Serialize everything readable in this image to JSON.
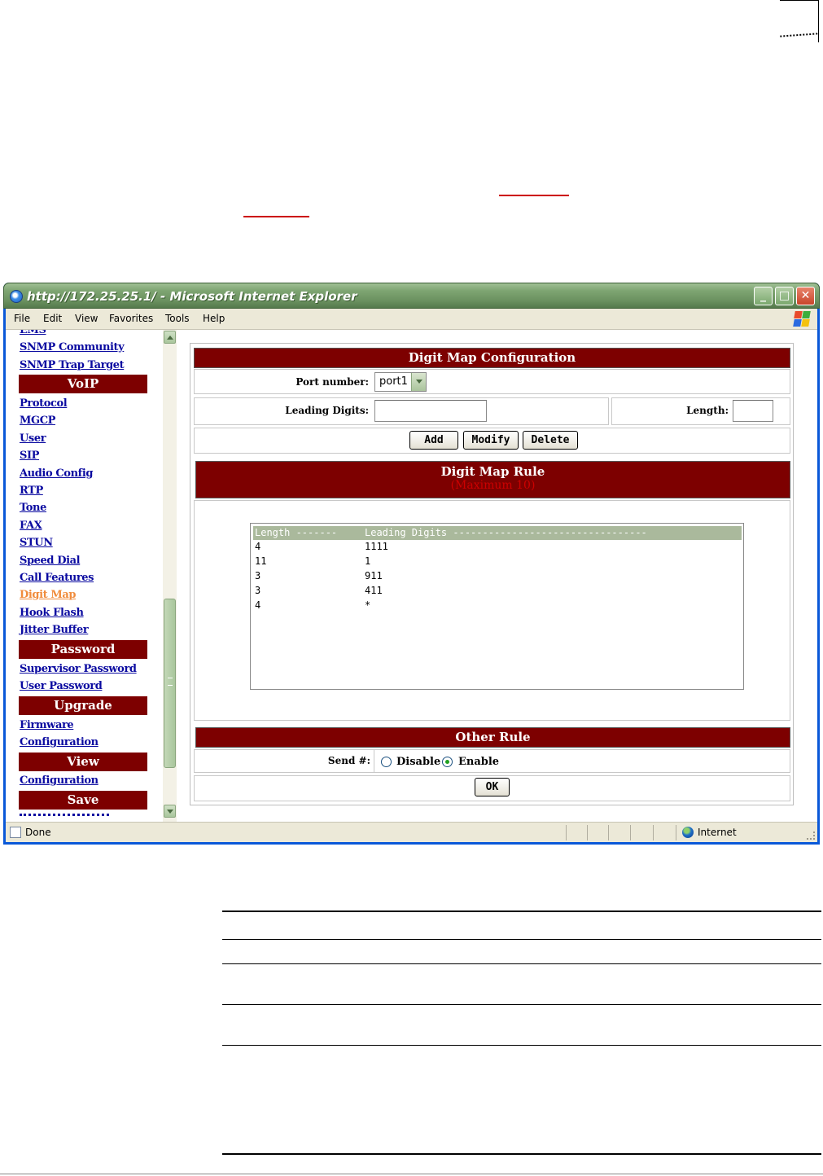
{
  "window": {
    "title": "http://172.25.25.1/ - Microsoft Internet Explorer",
    "buttons": [
      "minimize-icon",
      "maximize-icon",
      "close-icon"
    ]
  },
  "menu": [
    "File",
    "Edit",
    "View",
    "Favorites",
    "Tools",
    "Help"
  ],
  "sidebar": {
    "partial_top": "EMS",
    "items": [
      {
        "type": "link",
        "label": "SNMP Community"
      },
      {
        "type": "link",
        "label": "SNMP Trap Target"
      },
      {
        "type": "header",
        "label": "VoIP"
      },
      {
        "type": "link",
        "label": "Protocol"
      },
      {
        "type": "link",
        "label": "MGCP"
      },
      {
        "type": "link",
        "label": "User"
      },
      {
        "type": "link",
        "label": "SIP"
      },
      {
        "type": "link",
        "label": "Audio Config"
      },
      {
        "type": "link",
        "label": "RTP"
      },
      {
        "type": "link",
        "label": "Tone"
      },
      {
        "type": "link",
        "label": "FAX"
      },
      {
        "type": "link",
        "label": "STUN"
      },
      {
        "type": "link",
        "label": "Speed Dial"
      },
      {
        "type": "link",
        "label": "Call Features"
      },
      {
        "type": "link",
        "label": "Digit Map",
        "active": true
      },
      {
        "type": "link",
        "label": "Hook Flash"
      },
      {
        "type": "link",
        "label": "Jitter Buffer"
      },
      {
        "type": "header",
        "label": "Password"
      },
      {
        "type": "link",
        "label": "Supervisor Password"
      },
      {
        "type": "link",
        "label": "User Password"
      },
      {
        "type": "header",
        "label": "Upgrade"
      },
      {
        "type": "link",
        "label": "Firmware"
      },
      {
        "type": "link",
        "label": "Configuration"
      },
      {
        "type": "header",
        "label": "View"
      },
      {
        "type": "link",
        "label": "Configuration"
      },
      {
        "type": "header",
        "label": "Save"
      }
    ]
  },
  "config": {
    "title": "Digit Map Configuration",
    "port_label": "Port number:",
    "port_value": "port1",
    "leading_label": "Leading Digits:",
    "leading_value": "",
    "length_label": "Length:",
    "length_value": "",
    "add": "Add",
    "modify": "Modify",
    "delete": "Delete"
  },
  "rules": {
    "title": "Digit Map Rule",
    "subtitle": "(Maximum 10)",
    "header_length": "Length -------",
    "header_digits": "Leading Digits ---------------------------------",
    "rows": [
      {
        "length": "4",
        "digits": "1111"
      },
      {
        "length": "11",
        "digits": "1"
      },
      {
        "length": "3",
        "digits": "911"
      },
      {
        "length": "3",
        "digits": "411"
      },
      {
        "length": "4",
        "digits": "*"
      }
    ]
  },
  "other": {
    "title": "Other Rule",
    "send_label": "Send #:",
    "disable": "Disable",
    "enable": "Enable",
    "selected": "Enable",
    "ok": "OK"
  },
  "status": {
    "text": "Done",
    "zone": "Internet"
  },
  "colors": {
    "header_bg": "#7d0000",
    "link": "#0a0aa0",
    "active_link": "#f08c3c",
    "subtitle": "#cc0000"
  }
}
